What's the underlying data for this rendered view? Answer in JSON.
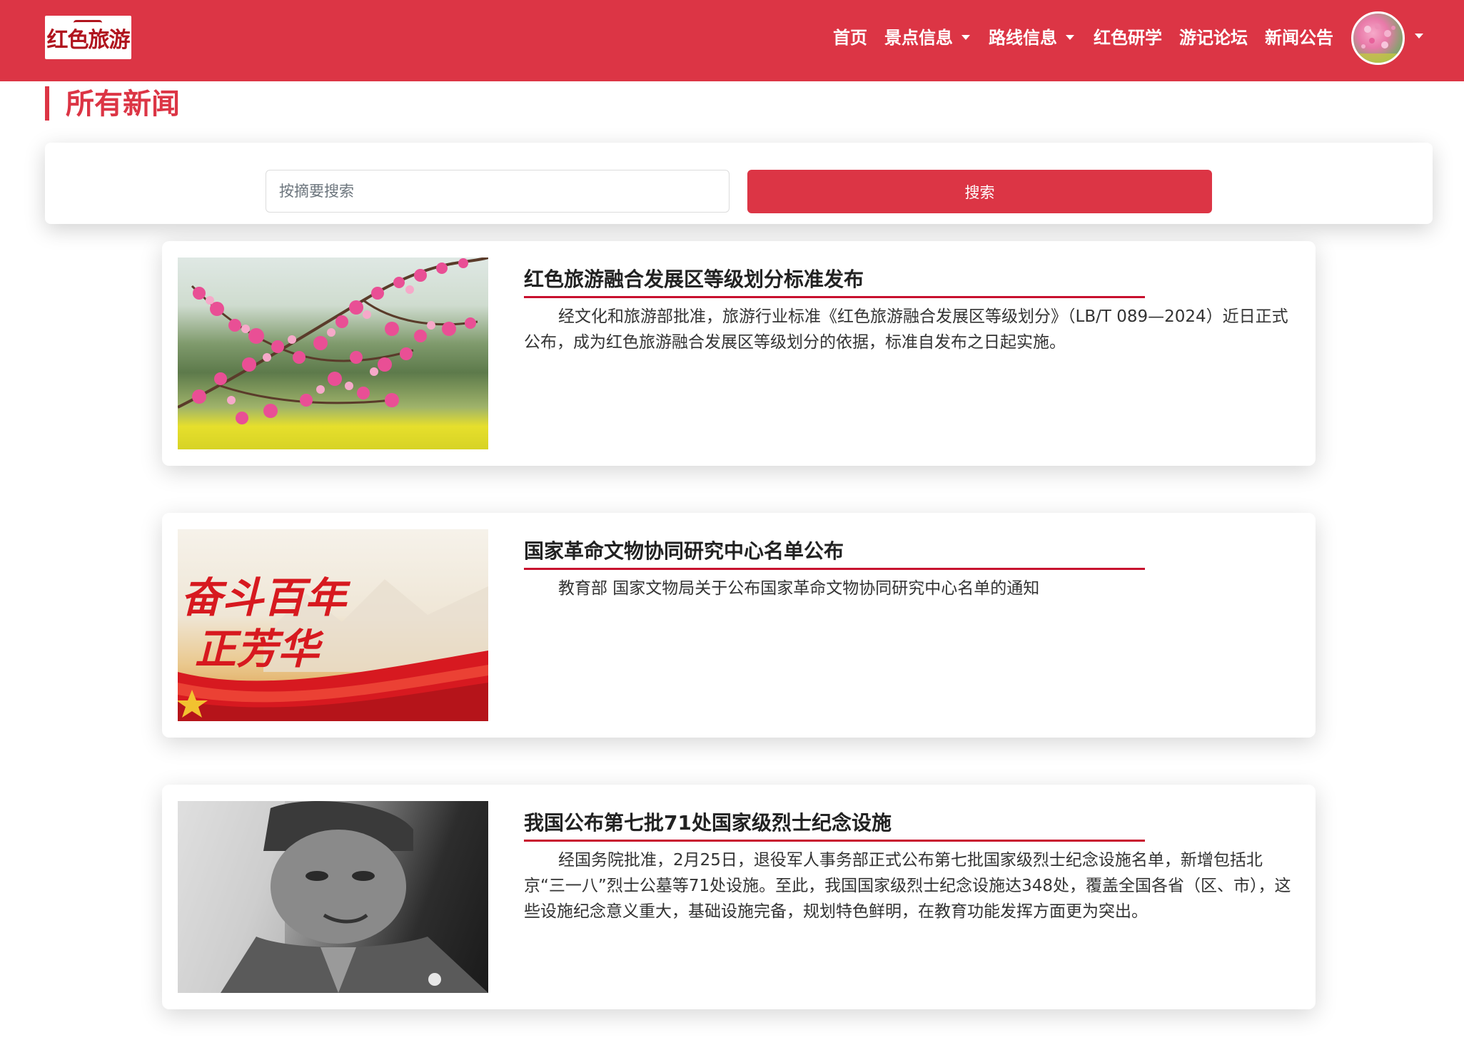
{
  "brand": {
    "logo_text": "红色旅游"
  },
  "nav": {
    "items": [
      {
        "label": "首页",
        "dropdown": false
      },
      {
        "label": "景点信息",
        "dropdown": true
      },
      {
        "label": "路线信息",
        "dropdown": true
      },
      {
        "label": "红色研学",
        "dropdown": false
      },
      {
        "label": "游记论坛",
        "dropdown": false
      },
      {
        "label": "新闻公告",
        "dropdown": false
      }
    ]
  },
  "page": {
    "title": "所有新闻"
  },
  "search": {
    "placeholder": "按摘要搜索",
    "value": "",
    "button_label": "搜索"
  },
  "news": [
    {
      "title": "红色旅游融合发展区等级划分标准发布",
      "summary": "经文化和旅游部批准，旅游行业标准《红色旅游融合发展区等级划分》（LB/T 089—2024）近日正式公布，成为红色旅游融合发展区等级划分的依据，标准自发布之日起实施。",
      "thumb_icon": "peach-blossom-image"
    },
    {
      "title": "国家革命文物协同研究中心名单公布",
      "summary": "教育部 国家文物局关于公布国家革命文物协同研究中心名单的通知",
      "thumb_icon": "red-banner-image",
      "thumb_text_line1": "奋斗百年",
      "thumb_text_line2": "正芳华"
    },
    {
      "title": "我国公布第七批71处国家级烈士纪念设施",
      "summary": "经国务院批准，2月25日，退役军人事务部正式公布第七批国家级烈士纪念设施名单，新增包括北京“三一八”烈士公墓等71处设施。至此，我国国家级烈士纪念设施达348处，覆盖全国各省（区、市），这些设施纪念意义重大，基础设施完备，规划特色鲜明，在教育功能发挥方面更为突出。",
      "thumb_icon": "portrait-photo-image"
    }
  ],
  "colors": {
    "primary": "#dc3545",
    "underline": "#c8102e",
    "text": "#333333"
  }
}
